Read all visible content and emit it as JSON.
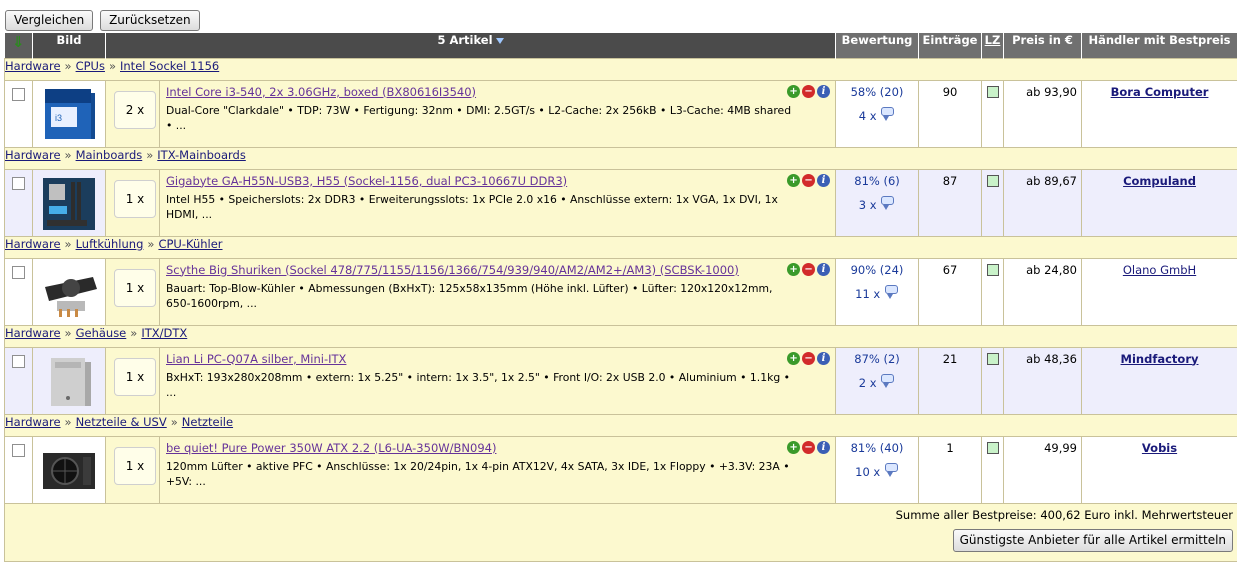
{
  "toolbar": {
    "compare_label": "Vergleichen",
    "reset_label": "Zurücksetzen"
  },
  "columns": {
    "sort_icon": "green-down-arrow",
    "bild": "Bild",
    "artikel": "5 Artikel",
    "bewertung": "Bewertung",
    "eintraege": "Einträge",
    "lz": "LZ",
    "preis": "Preis in €",
    "haendler": "Händler mit Bestpreis"
  },
  "icons": {
    "add": "+",
    "remove": "−",
    "info": "i"
  },
  "items": [
    {
      "categories": [
        "Hardware",
        "CPUs",
        "Intel Sockel 1156"
      ],
      "qty": "2 x",
      "name": "Intel Core i3-540, 2x 3.06GHz, boxed (BX80616I3540)",
      "desc": "Dual-Core \"Clarkdale\" • TDP: 73W • Fertigung: 32nm • DMI: 2.5GT/s • L2-Cache: 2x 256kB • L3-Cache: 4MB shared • ...",
      "rating": "58% (20)",
      "opinions": "4 x",
      "entries": "90",
      "price": "ab 93,90",
      "dealer": "Bora Computer",
      "dealer_bold": true,
      "image": "cpu-box"
    },
    {
      "categories": [
        "Hardware",
        "Mainboards",
        "ITX-Mainboards"
      ],
      "qty": "1 x",
      "name": "Gigabyte GA-H55N-USB3, H55 (Sockel-1156, dual PC3-10667U DDR3)",
      "desc": "Intel H55 • Speicherslots: 2x DDR3 • Erweiterungsslots: 1x PCIe 2.0 x16 • Anschlüsse extern: 1x VGA, 1x DVI, 1x HDMI, ...",
      "rating": "81% (6)",
      "opinions": "3 x",
      "entries": "87",
      "price": "ab 89,67",
      "dealer": "Compuland",
      "dealer_bold": true,
      "image": "mainboard"
    },
    {
      "categories": [
        "Hardware",
        "Luftkühlung",
        "CPU-Kühler"
      ],
      "qty": "1 x",
      "name": "Scythe Big Shuriken (Sockel 478/775/1155/1156/1366/754/939/940/AM2/AM2+/AM3) (SCBSK-1000)",
      "desc": "Bauart: Top-Blow-Kühler • Abmessungen (BxHxT): 125x58x135mm (Höhe inkl. Lüfter) • Lüfter: 120x120x12mm, 650-1600rpm, ...",
      "rating": "90% (24)",
      "opinions": "11 x",
      "entries": "67",
      "price": "ab 24,80",
      "dealer": "Olano GmbH",
      "dealer_bold": false,
      "image": "cpu-cooler"
    },
    {
      "categories": [
        "Hardware",
        "Gehäuse",
        "ITX/DTX"
      ],
      "qty": "1 x",
      "name": "Lian Li PC-Q07A silber, Mini-ITX",
      "desc": "BxHxT: 193x280x208mm • extern: 1x 5.25\" • intern: 1x 3.5\", 1x 2.5\" • Front I/O: 2x USB 2.0 • Aluminium • 1.1kg • ...",
      "rating": "87% (2)",
      "opinions": "2 x",
      "entries": "21",
      "price": "ab 48,36",
      "dealer": "Mindfactory",
      "dealer_bold": true,
      "image": "case"
    },
    {
      "categories": [
        "Hardware",
        "Netzteile & USV",
        "Netzteile"
      ],
      "qty": "1 x",
      "name": "be quiet! Pure Power 350W ATX 2.2 (L6-UA-350W/BN094)",
      "desc": "120mm Lüfter • aktive PFC • Anschlüsse: 1x 20/24pin, 1x 4-pin ATX12V, 4x SATA, 3x IDE, 1x Floppy • +3.3V: 23A • +5V: ...",
      "rating": "81% (40)",
      "opinions": "10 x",
      "entries": "1",
      "price": "49,99",
      "dealer": "Vobis",
      "dealer_bold": true,
      "image": "psu"
    }
  ],
  "footer": {
    "sum_text": "Summe aller Bestpreise: 400,62 Euro inkl. Mehrwertsteuer",
    "cheapest_label": "Günstigste Anbieter für alle Artikel ermitteln"
  }
}
